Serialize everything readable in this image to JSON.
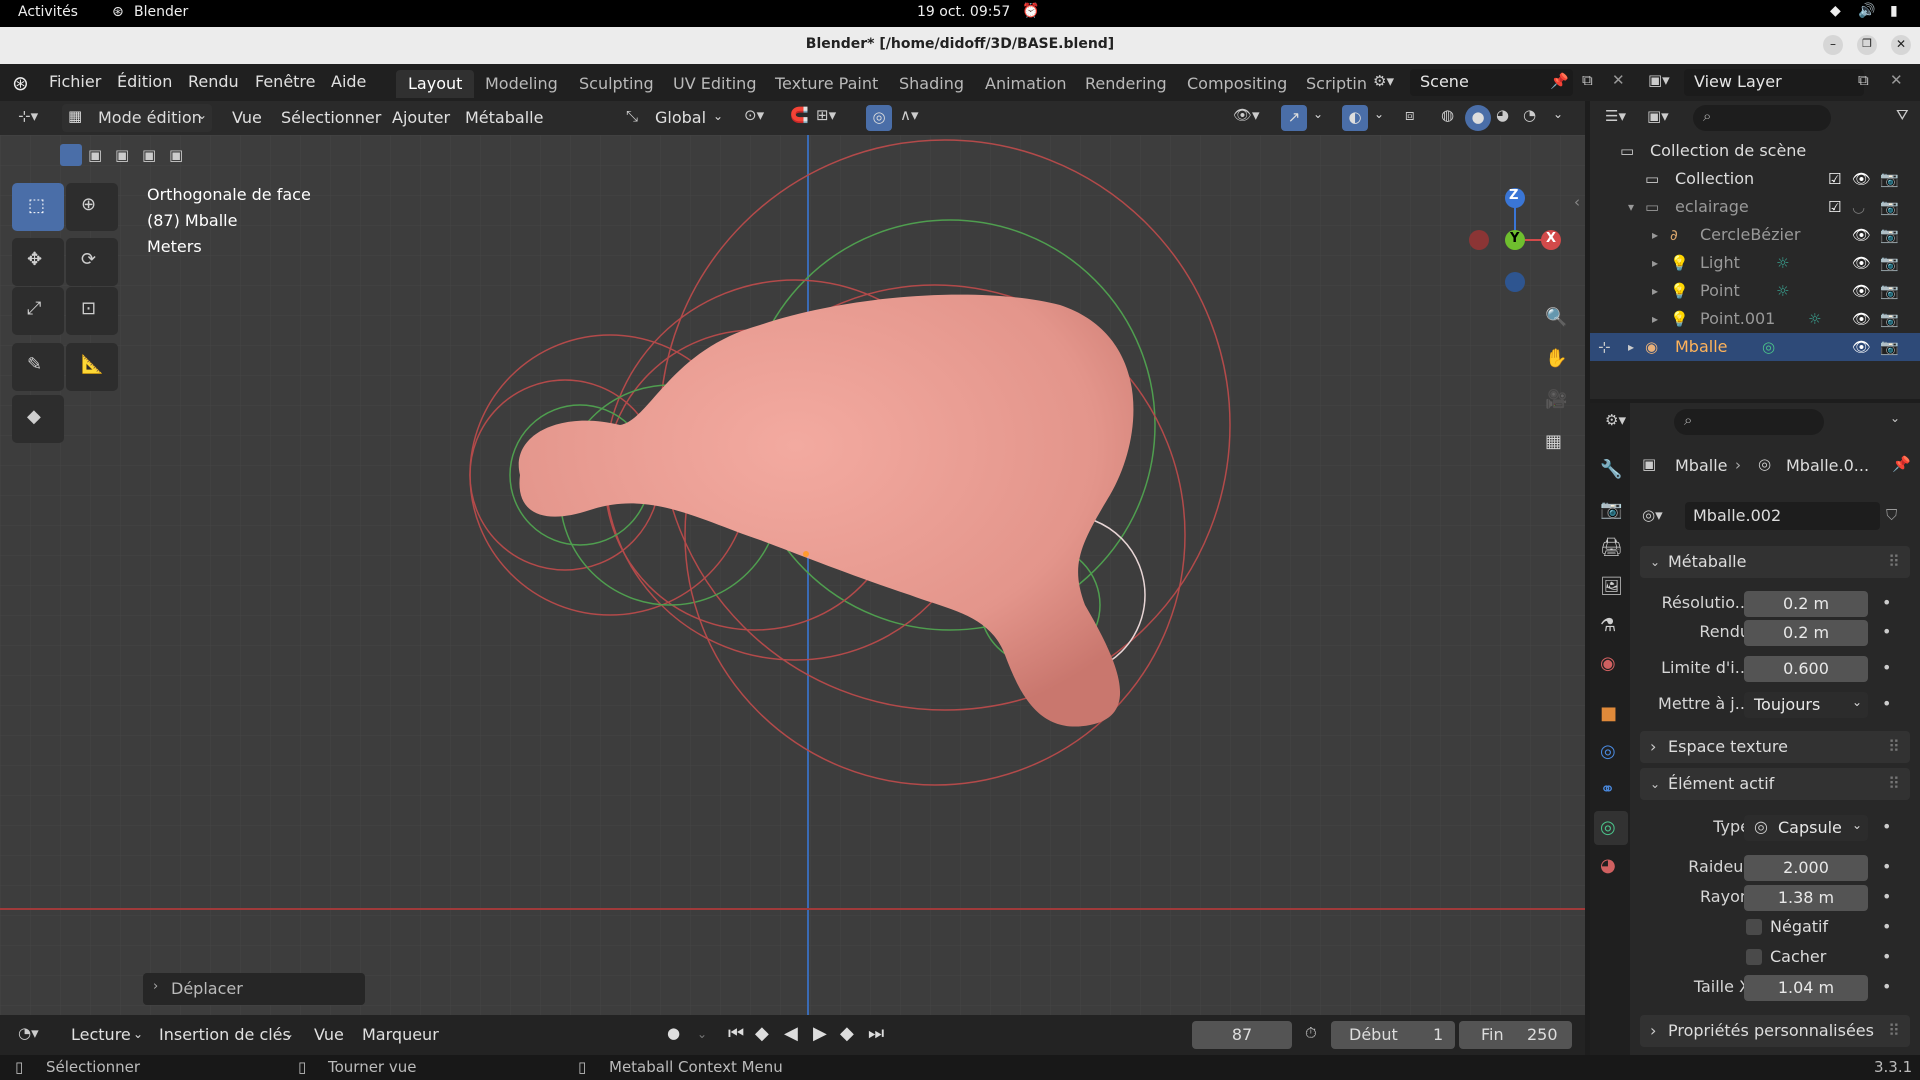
{
  "system": {
    "activities": "Activités",
    "app": "Blender",
    "datetime": "19 oct.  09:57"
  },
  "window": {
    "title": "Blender* [/home/didoff/3D/BASE.blend]"
  },
  "menus": [
    "Fichier",
    "Édition",
    "Rendu",
    "Fenêtre",
    "Aide"
  ],
  "workspaces": [
    "Layout",
    "Modeling",
    "Sculpting",
    "UV Editing",
    "Texture Paint",
    "Shading",
    "Animation",
    "Rendering",
    "Compositing",
    "Scriptin"
  ],
  "scene": {
    "name": "Scene",
    "view_layer": "View Layer"
  },
  "header3d": {
    "mode": "Mode édition",
    "vue": "Vue",
    "select": "Sélectionner",
    "add": "Ajouter",
    "metaball": "Métaballe",
    "orientation": "Global"
  },
  "overlay": {
    "view_name": "Orthogonale de face",
    "object": "(87) Mballe",
    "units": "Meters"
  },
  "gizmo": {
    "z": "Z",
    "y": "Y",
    "x": "X"
  },
  "last_op": "Déplacer",
  "outliner": {
    "scene_collection": "Collection de scène",
    "items": [
      {
        "label": "Collection"
      },
      {
        "label": "eclairage"
      },
      {
        "label": "CercleBézier"
      },
      {
        "label": "Light"
      },
      {
        "label": "Point"
      },
      {
        "label": "Point.001"
      },
      {
        "label": "Mballe"
      }
    ]
  },
  "props": {
    "breadcrumb_obj": "Mballe",
    "breadcrumb_data": "Mballe.0...",
    "datablock": "Mballe.002",
    "metaball_section": "Métaballe",
    "resolution_label": "Résolutio...",
    "resolution_value": "0.2 m",
    "render_label": "Rendu",
    "render_value": "0.2 m",
    "threshold_label": "Limite d'i...",
    "threshold_value": "0.600",
    "update_label": "Mettre à j...",
    "update_value": "Toujours",
    "texture_space": "Espace texture",
    "active_element": "Élément actif",
    "type_label": "Type",
    "type_value": "Capsule",
    "stiffness_label": "Raideur",
    "stiffness_value": "2.000",
    "radius_label": "Rayon",
    "radius_value": "1.38 m",
    "negative_label": "Négatif",
    "hide_label": "Cacher",
    "sizex_label": "Taille X",
    "sizex_value": "1.04 m",
    "custom_props": "Propriétés personnalisées"
  },
  "timeline": {
    "playback": "Lecture",
    "keying": "Insertion de clés",
    "view": "Vue",
    "marker": "Marqueur",
    "current_frame": "87",
    "start_label": "Début",
    "start": "1",
    "end_label": "Fin",
    "end": "250"
  },
  "status": {
    "select": "Sélectionner",
    "rotate": "Tourner vue",
    "context": "Metaball Context Menu",
    "version": "3.3.1"
  },
  "colors": {
    "accent": "#4a6ea8",
    "metaball": "#e39a8f",
    "selection": "#2e4a78"
  }
}
